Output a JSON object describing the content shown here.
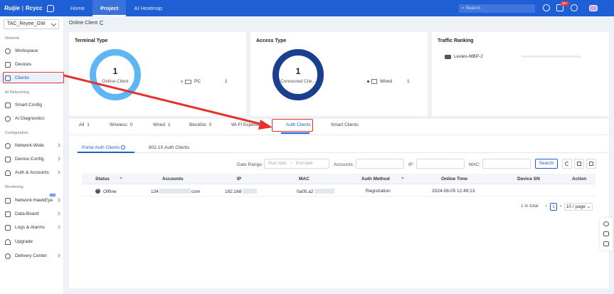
{
  "topbar": {
    "brand": "Ruijie",
    "brand_sub": "Rcycc",
    "tabs": [
      {
        "label": "Home",
        "active": false
      },
      {
        "label": "Project",
        "active": true
      },
      {
        "label": "AI Heatmap",
        "active": false
      }
    ],
    "search_placeholder": "Search",
    "notification_badge": "99+"
  },
  "sidebar": {
    "site": "TAC_Reyee_GW",
    "sections": {
      "network": "Network",
      "ai_networking": "AI Networking",
      "configuration": "Configuration",
      "monitoring": "Monitoring"
    },
    "items": {
      "workspace": "Workspace",
      "devices": "Devices",
      "clients": "Clients",
      "smart_config": "Smart Config",
      "ai_diagnostics": "AI Diagnostics",
      "network_wide": "Network-Wide",
      "device_config": "Device Config",
      "auth_accounts": "Auth & Accounts",
      "network_hawkeye": "Network HawkEye",
      "data_board": "Data-Board",
      "logs_alarms": "Logs & Alarms",
      "upgrade": "Upgrade",
      "delivery_center": "Delivery Center"
    },
    "new_tag": "new"
  },
  "page": {
    "title": "Online Client"
  },
  "terminal_card": {
    "title": "Terminal Type",
    "donut_value": "1",
    "donut_label": "Online Client",
    "legend_label": "PC",
    "legend_count": "1",
    "color": "#5fb6f5"
  },
  "access_card": {
    "title": "Access Type",
    "donut_value": "1",
    "donut_label": "Connected Clie...",
    "legend_label": "Wired",
    "legend_count": "1",
    "color": "#1a3f8f"
  },
  "traffic_card": {
    "title": "Traffic Ranking",
    "entry": "Lexies-MBP-2"
  },
  "tabs": [
    {
      "label": "All",
      "count": "1"
    },
    {
      "label": "Wireless",
      "count": "0"
    },
    {
      "label": "Wired",
      "count": "1"
    },
    {
      "label": "Blocklist",
      "count": "0"
    },
    {
      "label": "Wi-Fi Experience",
      "count": ""
    },
    {
      "label": "Auth Clients",
      "count": ""
    },
    {
      "label": "Smart Clients",
      "count": ""
    }
  ],
  "subtabs": {
    "portal": "Portal Auth Clients",
    "dot1x": "802.1X Auth Clients"
  },
  "filters": {
    "date_range_label": "Date Range:",
    "start_placeholder": "Start date",
    "range_sep": "~",
    "end_placeholder": "End date",
    "accounts_label": "Accounts:",
    "ip_label": "IP:",
    "mac_label": "MAC:",
    "search_button": "Search"
  },
  "table": {
    "headers": {
      "status": "Status",
      "accounts": "Accounts",
      "ip": "IP",
      "mac": "MAC",
      "auth_method": "Auth Method",
      "online_time": "Online Time",
      "device_sn": "Device SN",
      "action": "Action"
    },
    "row": {
      "status": "Offline",
      "account_prefix": "134",
      "account_suffix": "com",
      "ip_prefix": "192.168",
      "mac_prefix": "0a05.a2",
      "auth_method": "Registration",
      "online_time": "2024-08-05 12:49:13"
    }
  },
  "pagination": {
    "total": "1 in total",
    "current_page": "1",
    "page_size": "10 / page"
  },
  "annotation_color": "#e5322d"
}
